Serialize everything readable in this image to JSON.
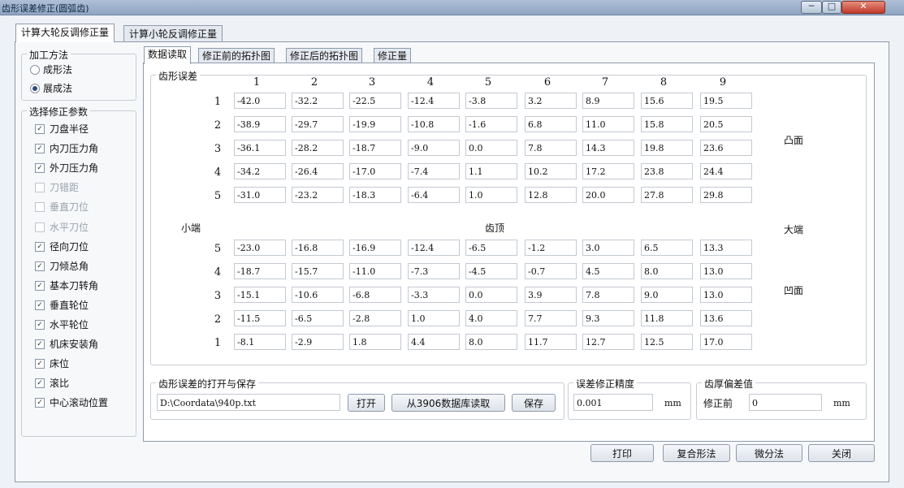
{
  "window": {
    "title": "齿形误差修正(圆弧齿)",
    "min": "─",
    "max": "□",
    "close": "✕"
  },
  "outer_tabs": [
    "计算大轮反调修正量",
    "计算小轮反调修正量"
  ],
  "method": {
    "title": "加工方法",
    "options": [
      "成形法",
      "展成法"
    ],
    "selected": 1
  },
  "params": {
    "title": "选择修正参数",
    "items": [
      {
        "label": "刀盘半径",
        "checked": true
      },
      {
        "label": "内刀压力角",
        "checked": true
      },
      {
        "label": "外刀压力角",
        "checked": true
      },
      {
        "label": "刀错距",
        "checked": false
      },
      {
        "label": "垂直刀位",
        "checked": false
      },
      {
        "label": "水平刀位",
        "checked": false
      },
      {
        "label": "径向刀位",
        "checked": true
      },
      {
        "label": "刀倾总角",
        "checked": true
      },
      {
        "label": "基本刀转角",
        "checked": true
      },
      {
        "label": "垂直轮位",
        "checked": true
      },
      {
        "label": "水平轮位",
        "checked": true
      },
      {
        "label": "机床安装角",
        "checked": true
      },
      {
        "label": "床位",
        "checked": true
      },
      {
        "label": "滚比",
        "checked": true
      },
      {
        "label": "中心滚动位置",
        "checked": true
      }
    ]
  },
  "inner_tabs": [
    "数据读取",
    "修正前的拓扑图",
    "修正后的拓扑图",
    "修正量"
  ],
  "grid": {
    "title": "齿形误差",
    "columns": [
      "1",
      "2",
      "3",
      "4",
      "5",
      "6",
      "7",
      "8",
      "9"
    ],
    "convex": {
      "label": "凸面",
      "rows": [
        {
          "id": "1",
          "values": [
            "-42.0",
            "-32.2",
            "-22.5",
            "-12.4",
            "-3.8",
            "3.2",
            "8.9",
            "15.6",
            "19.5"
          ]
        },
        {
          "id": "2",
          "values": [
            "-38.9",
            "-29.7",
            "-19.9",
            "-10.8",
            "-1.6",
            "6.8",
            "11.0",
            "15.8",
            "20.5"
          ]
        },
        {
          "id": "3",
          "values": [
            "-36.1",
            "-28.2",
            "-18.7",
            "-9.0",
            "0.0",
            "7.8",
            "14.3",
            "19.8",
            "23.6"
          ]
        },
        {
          "id": "4",
          "values": [
            "-34.2",
            "-26.4",
            "-17.0",
            "-7.4",
            "1.1",
            "10.2",
            "17.2",
            "23.8",
            "24.4"
          ]
        },
        {
          "id": "5",
          "values": [
            "-31.0",
            "-23.2",
            "-18.3",
            "-6.4",
            "1.0",
            "12.8",
            "20.0",
            "27.8",
            "29.8"
          ]
        }
      ]
    },
    "small_end": "小端",
    "tip": "齿顶",
    "large_end": "大端",
    "concave": {
      "label": "凹面",
      "rows": [
        {
          "id": "5",
          "values": [
            "-23.0",
            "-16.8",
            "-16.9",
            "-12.4",
            "-6.5",
            "-1.2",
            "3.0",
            "6.5",
            "13.3"
          ]
        },
        {
          "id": "4",
          "values": [
            "-18.7",
            "-15.7",
            "-11.0",
            "-7.3",
            "-4.5",
            "-0.7",
            "4.5",
            "8.0",
            "13.0"
          ]
        },
        {
          "id": "3",
          "values": [
            "-15.1",
            "-10.6",
            "-6.8",
            "-3.3",
            "0.0",
            "3.9",
            "7.8",
            "9.0",
            "13.0"
          ]
        },
        {
          "id": "2",
          "values": [
            "-11.5",
            "-6.5",
            "-2.8",
            "1.0",
            "4.0",
            "7.7",
            "9.3",
            "11.8",
            "13.6"
          ]
        },
        {
          "id": "1",
          "values": [
            "-8.1",
            "-2.9",
            "1.8",
            "4.4",
            "8.0",
            "11.7",
            "12.7",
            "12.5",
            "17.0"
          ]
        }
      ]
    }
  },
  "file": {
    "title": "齿形误差的打开与保存",
    "path": "D:\\Coordata\\940p.txt",
    "open": "打开",
    "read_db": "从3906数据库读取",
    "save": "保存"
  },
  "precision": {
    "title": "误差修正精度",
    "value": "0.001",
    "unit": "mm"
  },
  "thickness": {
    "title": "齿厚偏差值",
    "label": "修正前",
    "value": "0",
    "unit": "mm"
  },
  "actions": [
    "打印",
    "复合形法",
    "微分法",
    "关闭"
  ]
}
